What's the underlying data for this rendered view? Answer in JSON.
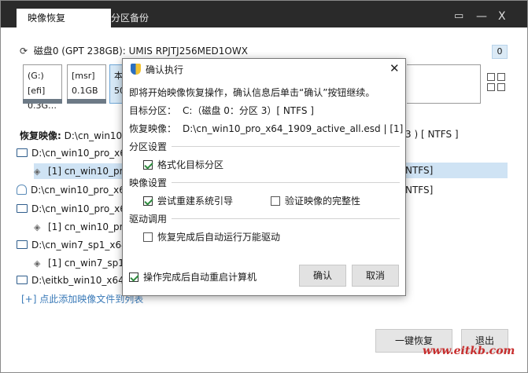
{
  "tabs": [
    {
      "label": "映像恢复",
      "active": true
    },
    {
      "label": "分区备份",
      "active": false
    }
  ],
  "window_controls": {
    "minimize": "▭",
    "maximize": "—",
    "close": "X"
  },
  "disk": {
    "label": "磁盘0 (GPT 238GB): UMIS RPJTJ256MED1OWX",
    "badge": "0"
  },
  "partitions": [
    {
      "name": "(G:)[efi]",
      "size": "0.3G…"
    },
    {
      "name": "[msr]",
      "size": "0.1GB"
    },
    {
      "name": "本",
      "size": "50"
    }
  ],
  "restore_label": "恢复映像:",
  "restore_path": "D:\\cn_win10",
  "right_info": "3 ) [ NTFS ]",
  "tree": [
    {
      "type": "file",
      "text": "D:\\cn_win10_pro_x6"
    },
    {
      "type": "image",
      "text": "[1] cn_win10_pro",
      "selected": true
    },
    {
      "type": "ghost",
      "text": "D:\\cn_win10_pro_x6"
    },
    {
      "type": "file",
      "text": "D:\\cn_win10_pro_x6"
    },
    {
      "type": "image",
      "text": "[1] cn_win10_pro"
    },
    {
      "type": "file",
      "text": "D:\\cn_win7_sp1_x64"
    },
    {
      "type": "image",
      "text": "[1] cn_win7_sp1_x"
    },
    {
      "type": "file",
      "text": "D:\\eitkb_win10_x64"
    }
  ],
  "right_ntfs": [
    "NTFS]",
    "NTFS]"
  ],
  "add_link": "[+] 点此添加映像文件到列表",
  "buttons": {
    "restore": "一键恢复",
    "exit": "退出"
  },
  "watermark": "www.eitkb.com",
  "dialog": {
    "title": "确认执行",
    "close": "✕",
    "intro": "即将开始映像恢复操作，确认信息后单击“确认”按钮继续。",
    "target_label": "目标分区：",
    "target_value": "C:（磁盘 0：分区 3）[ NTFS ]",
    "image_label": "恢复映像：",
    "image_value": "D:\\cn_win10_pro_x64_1909_active_all.esd | [1]",
    "section_partition": "分区设置",
    "opt_format": "格式化目标分区",
    "section_image": "映像设置",
    "opt_rebuild_boot": "尝试重建系统引导",
    "opt_verify": "验证映像的完整性",
    "section_driver": "驱动调用",
    "opt_driver": "恢复完成后自动运行万能驱动",
    "opt_restart": "操作完成后自动重启计算机",
    "confirm": "确认",
    "cancel": "取消"
  }
}
